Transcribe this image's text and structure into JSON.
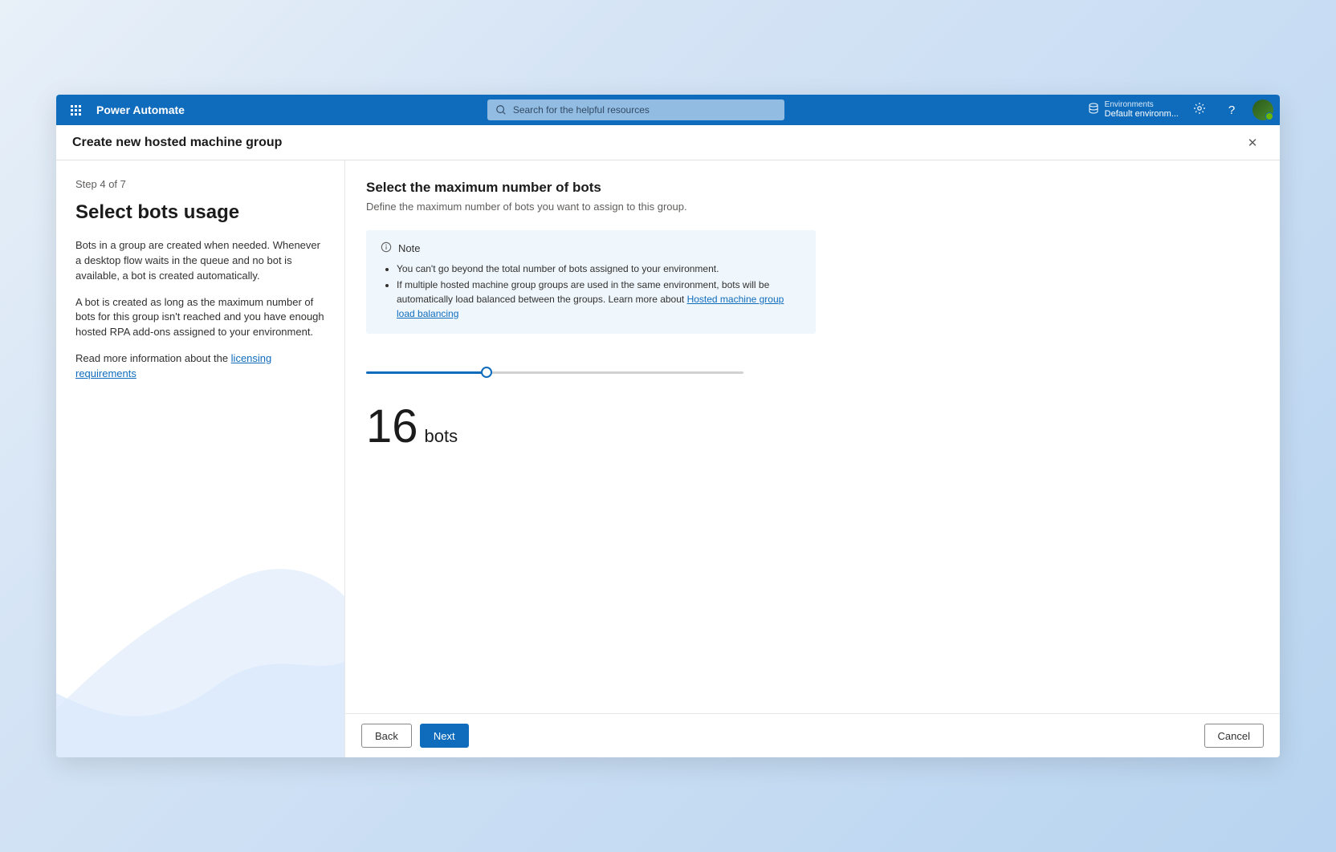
{
  "header": {
    "app_name": "Power Automate",
    "search_placeholder": "Search for the helpful resources",
    "env_label": "Environments",
    "env_value": "Default environm..."
  },
  "page": {
    "title": "Create new hosted machine group"
  },
  "sidebar": {
    "step_label": "Step 4 of 7",
    "title": "Select bots usage",
    "p1": "Bots in a group are created when needed. Whenever a desktop flow waits in the queue and no bot is available, a bot is created automatically.",
    "p2": "A bot is created as long as the maximum number of bots for this group isn't reached and you have enough hosted RPA add-ons assigned to your environment.",
    "p3_prefix": "Read more information about the ",
    "p3_link": "licensing requirements"
  },
  "main": {
    "title": "Select the maximum number of bots",
    "subtitle": "Define the maximum number of bots you want to assign to this group.",
    "note": {
      "label": "Note",
      "item1": "You can't go beyond the total number of bots assigned to your environment.",
      "item2_prefix": "If multiple hosted machine group groups are used in the same environment, bots will be automatically load balanced between the groups. Learn more about ",
      "item2_link": "Hosted machine group load balancing"
    },
    "slider": {
      "value": 16,
      "min": 0,
      "max": 50,
      "percent": 32
    },
    "readout": {
      "number": "16",
      "unit": "bots"
    }
  },
  "buttons": {
    "back": "Back",
    "next": "Next",
    "cancel": "Cancel"
  }
}
